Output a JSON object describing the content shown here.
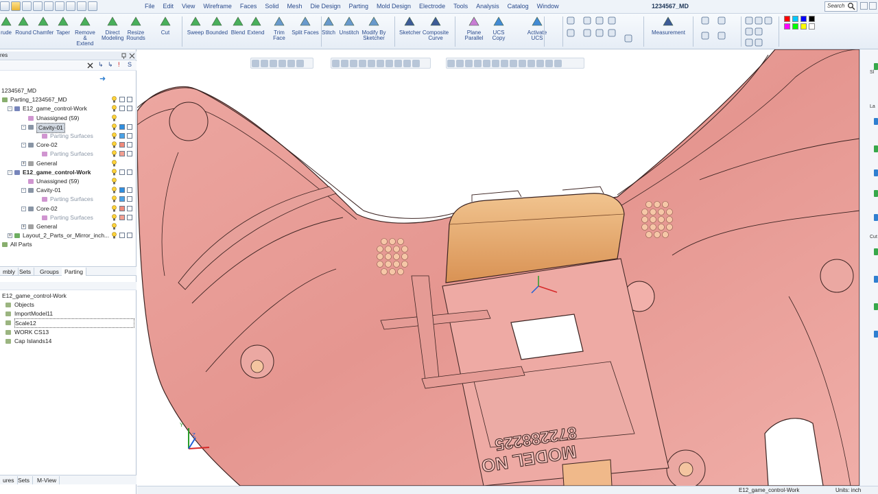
{
  "menu": [
    "File",
    "Edit",
    "View",
    "Wireframe",
    "Faces",
    "Solid",
    "Mesh",
    "Die Design",
    "Parting",
    "Mold Design",
    "Electrode",
    "Tools",
    "Analysis",
    "Catalog",
    "Window"
  ],
  "document_title": "1234567_MD",
  "search_placeholder": "Search",
  "ribbon_buttons": [
    {
      "label": "rude",
      "label2": ""
    },
    {
      "label": "Round",
      "label2": ""
    },
    {
      "label": "Chamfer",
      "label2": ""
    },
    {
      "label": "Taper",
      "label2": ""
    },
    {
      "label": "Remove &",
      "label2": "Extend"
    },
    {
      "label": "Direct",
      "label2": "Modeling"
    },
    {
      "label": "Resize",
      "label2": "Rounds"
    },
    {
      "label": "Cut",
      "label2": ""
    },
    {
      "label": "Sweep",
      "label2": ""
    },
    {
      "label": "Bounded",
      "label2": ""
    },
    {
      "label": "Blend",
      "label2": ""
    },
    {
      "label": "Extend",
      "label2": ""
    },
    {
      "label": "Trim Face",
      "label2": ""
    },
    {
      "label": "Split Faces",
      "label2": ""
    },
    {
      "label": "Stitch",
      "label2": ""
    },
    {
      "label": "Unstitch",
      "label2": ""
    },
    {
      "label": "Modify By",
      "label2": "Sketcher"
    },
    {
      "label": "Sketcher",
      "label2": ""
    },
    {
      "label": "Composite",
      "label2": "Curve"
    },
    {
      "label": "Plane Parallel",
      "label2": ""
    },
    {
      "label": "UCS Copy",
      "label2": ""
    },
    {
      "label": "Activate UCS",
      "label2": ""
    },
    {
      "label": "Measurement",
      "label2": ""
    }
  ],
  "left_panel": {
    "header_label": "res",
    "tree": [
      {
        "label": "1234567_MD",
        "level": 0,
        "expander": "",
        "icon": "none",
        "bold": false,
        "muted": false,
        "selected": false,
        "cols": false
      },
      {
        "label": "Parting_1234567_MD",
        "level": 0,
        "expander": "-",
        "icon": "assembly",
        "bold": false,
        "muted": false,
        "selected": false,
        "cols": true,
        "c1": "#ffffff",
        "c2": "#ffffff"
      },
      {
        "label": "E12_game_control-Work",
        "level": 1,
        "expander": "-",
        "icon": "part",
        "bold": false,
        "muted": false,
        "selected": false,
        "cols": true,
        "c1": "#ffffff",
        "c2": "#ffffff"
      },
      {
        "label": "Unassigned (59)",
        "level": 2,
        "expander": "",
        "icon": "surface",
        "bold": false,
        "muted": false,
        "selected": false,
        "cols": true,
        "bulbonly": true
      },
      {
        "label": "Cavity-01",
        "level": 2,
        "expander": "-",
        "icon": "body",
        "bold": false,
        "muted": false,
        "selected": true,
        "cols": true,
        "c1": "#2f8fe0",
        "c2": "#ffffff"
      },
      {
        "label": "Parting Surfaces",
        "level": 3,
        "expander": "",
        "icon": "surface",
        "bold": false,
        "muted": true,
        "selected": false,
        "cols": true,
        "c1": "#4aa3e8",
        "c2": "#ffffff"
      },
      {
        "label": "Core-02",
        "level": 2,
        "expander": "-",
        "icon": "body",
        "bold": false,
        "muted": false,
        "selected": false,
        "cols": true,
        "c1": "#f08a7a",
        "c2": "#ffffff"
      },
      {
        "label": "Parting Surfaces",
        "level": 3,
        "expander": "",
        "icon": "surface",
        "bold": false,
        "muted": true,
        "selected": false,
        "cols": true,
        "c1": "#f3a092",
        "c2": "#ffffff"
      },
      {
        "label": "General",
        "level": 2,
        "expander": "+",
        "icon": "folder",
        "bold": false,
        "muted": false,
        "selected": false,
        "cols": true,
        "bulbonly": true
      },
      {
        "label": "E12_game_control-Work",
        "level": 1,
        "expander": "-",
        "icon": "part",
        "bold": true,
        "muted": false,
        "selected": false,
        "cols": true,
        "c1": "#ffffff",
        "c2": "#ffffff"
      },
      {
        "label": "Unassigned (59)",
        "level": 2,
        "expander": "",
        "icon": "surface",
        "bold": false,
        "muted": false,
        "selected": false,
        "cols": true,
        "bulbonly": true
      },
      {
        "label": "Cavity-01",
        "level": 2,
        "expander": "-",
        "icon": "body",
        "bold": false,
        "muted": false,
        "selected": false,
        "cols": true,
        "c1": "#2f8fe0",
        "c2": "#ffffff"
      },
      {
        "label": "Parting Surfaces",
        "level": 3,
        "expander": "",
        "icon": "surface",
        "bold": false,
        "muted": true,
        "selected": false,
        "cols": true,
        "c1": "#4aa3e8",
        "c2": "#ffffff"
      },
      {
        "label": "Core-02",
        "level": 2,
        "expander": "-",
        "icon": "body",
        "bold": false,
        "muted": false,
        "selected": false,
        "cols": true,
        "c1": "#f08a7a",
        "c2": "#ffffff"
      },
      {
        "label": "Parting Surfaces",
        "level": 3,
        "expander": "",
        "icon": "surface",
        "bold": false,
        "muted": true,
        "selected": false,
        "cols": true,
        "c1": "#f3a092",
        "c2": "#ffffff"
      },
      {
        "label": "General",
        "level": 2,
        "expander": "+",
        "icon": "folder",
        "bold": false,
        "muted": false,
        "selected": false,
        "cols": true,
        "bulbonly": true
      },
      {
        "label": "Layout_2_Parts_or_Mirror_inch...",
        "level": 1,
        "expander": "+",
        "icon": "layout",
        "bold": false,
        "muted": false,
        "selected": false,
        "cols": true,
        "c1": "#ffffff",
        "c2": "#ffffff"
      },
      {
        "label": "All Parts",
        "level": 0,
        "expander": "",
        "icon": "assembly",
        "bold": false,
        "muted": false,
        "selected": false,
        "cols": false
      }
    ],
    "tabs": [
      "mbly",
      "Sets",
      "Groups",
      "Parting"
    ],
    "active_tab": "Parting",
    "object_list_title": "E12_game_control-Work",
    "object_list": [
      {
        "label": "Objects",
        "icon": "objects"
      },
      {
        "label": "ImportModel11",
        "icon": "import"
      },
      {
        "label": "Scale12",
        "icon": "scale"
      },
      {
        "label": "WORK CS13",
        "icon": "csys"
      },
      {
        "label": "Cap Islands14",
        "icon": "cap"
      }
    ],
    "bottom_tabs": [
      "ures",
      "Sets",
      "M-View"
    ]
  },
  "model": {
    "label_line1": "MODEL NO",
    "label_line2": "872288225",
    "body_color": "#e89d98",
    "edge_color": "#3a2220",
    "highlight_color": "#e4a76c"
  },
  "right_strip_labels": [
    "Sl",
    "La",
    "Cut"
  ],
  "status": {
    "object": "E12_game_control-Work",
    "units": "Units: inch"
  },
  "colors": {
    "accent": "#2a4b8d",
    "cavity": "#2f8fe0",
    "core": "#f08a7a"
  }
}
